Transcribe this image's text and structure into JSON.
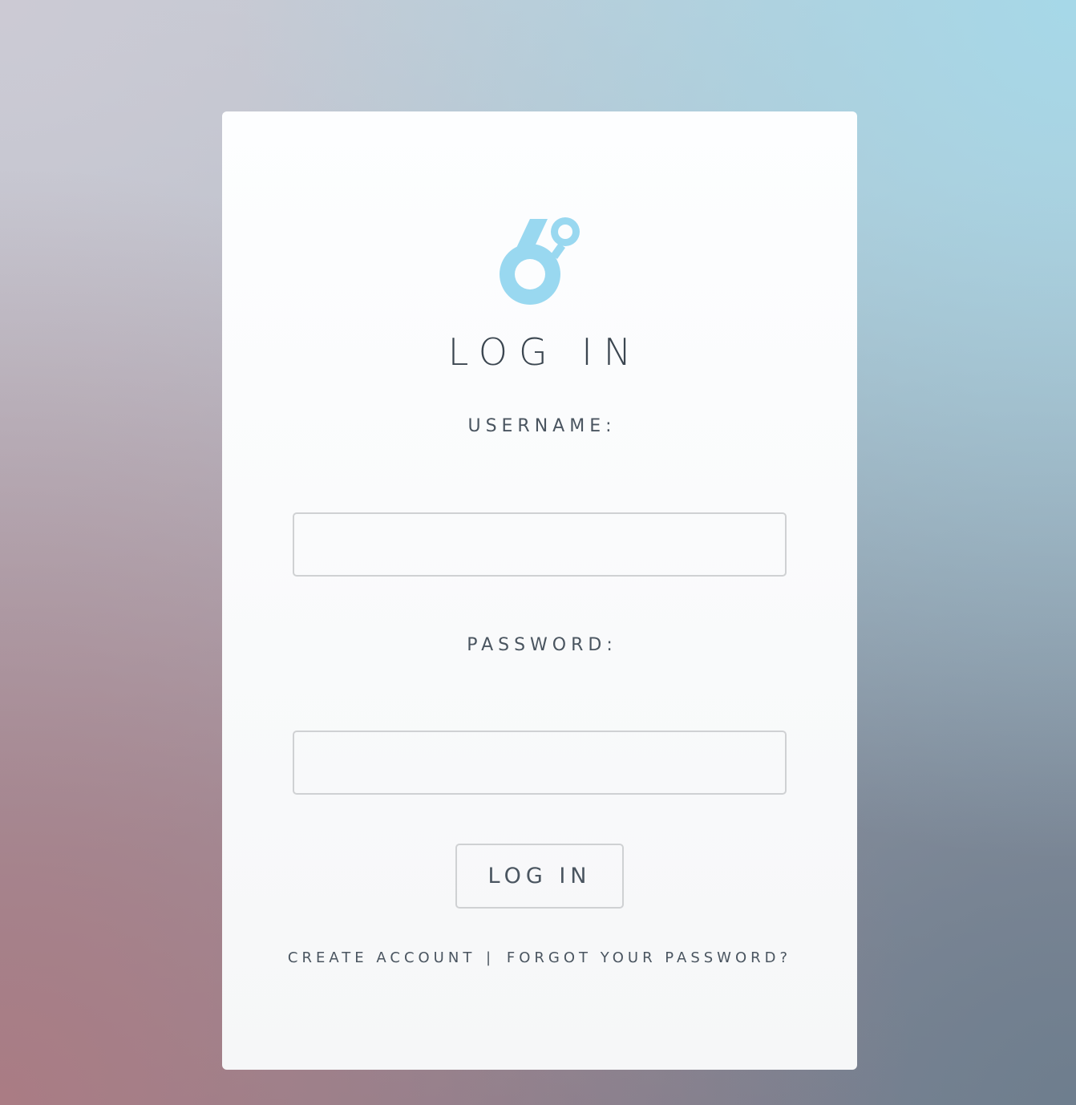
{
  "colors": {
    "logo": "#99d8f0",
    "text": "#3b4650",
    "border": "#cfd1d3"
  },
  "logo": {
    "icon": "six-degrees-logo-icon"
  },
  "heading": "LOG IN",
  "form": {
    "username_label": "USERNAME:",
    "username_value": "",
    "password_label": "PASSWORD:",
    "password_value": "",
    "submit_label": "LOG IN"
  },
  "links": {
    "create_account": "CREATE ACCOUNT",
    "separator": "|",
    "forgot_password": "FORGOT YOUR PASSWORD?"
  }
}
